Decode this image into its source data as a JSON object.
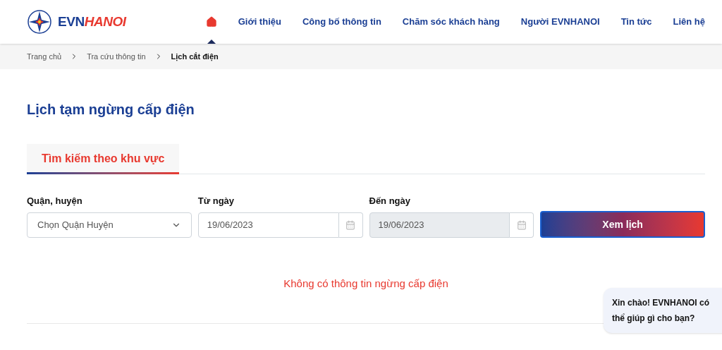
{
  "logo": {
    "prefix": "EVN",
    "suffix": "HANOI"
  },
  "nav": [
    {
      "kind": "home",
      "selected": true
    },
    {
      "kind": "link",
      "label": "Giới thiệu",
      "selected": false
    },
    {
      "kind": "link",
      "label": "Công bố thông tin",
      "selected": false
    },
    {
      "kind": "link",
      "label": "Chăm sóc khách hàng",
      "selected": false
    },
    {
      "kind": "link",
      "label": "Người EVNHANOI",
      "selected": false
    },
    {
      "kind": "link",
      "label": "Tin tức",
      "selected": false
    },
    {
      "kind": "link",
      "label": "Liên hệ",
      "selected": false
    }
  ],
  "breadcrumb": [
    {
      "label": "Trang chủ",
      "current": false
    },
    {
      "label": "Tra cứu thông tin",
      "current": false
    },
    {
      "label": "Lịch cắt điện",
      "current": true
    }
  ],
  "page_title": "Lịch tạm ngừng cấp điện",
  "tabs": [
    {
      "label": "Tìm kiếm theo khu vực",
      "selected": true
    }
  ],
  "fields": [
    {
      "kind": "select",
      "label": "Quận, huyện",
      "value": "Chọn Quận Huyện",
      "disabled": false
    },
    {
      "kind": "date",
      "label": "Từ ngày",
      "value": "19/06/2023",
      "disabled": false
    },
    {
      "kind": "date",
      "label": "Đến ngày",
      "value": "19/06/2023",
      "disabled": true
    }
  ],
  "submit_button": "Xem lịch",
  "message": "Không có thông tin ngừng cấp điện",
  "chat_bubble": "Xin chào! EVNHANOI có thể giúp gì cho bạn?"
}
